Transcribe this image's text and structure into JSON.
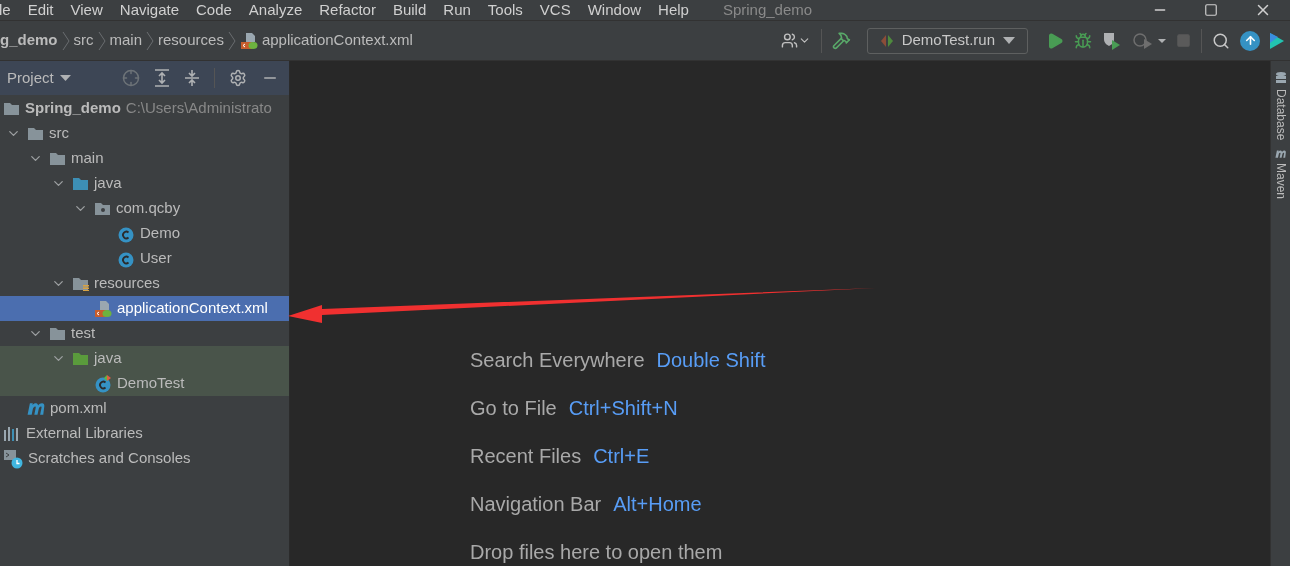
{
  "menu": [
    "le",
    "Edit",
    "View",
    "Navigate",
    "Code",
    "Analyze",
    "Refactor",
    "Build",
    "Run",
    "Tools",
    "VCS",
    "Window",
    "Help"
  ],
  "window": {
    "title": "Spring_demo"
  },
  "breadcrumbs": [
    {
      "label": "g_demo",
      "kind": "project"
    },
    {
      "label": "src",
      "kind": "folder"
    },
    {
      "label": "main",
      "kind": "folder"
    },
    {
      "label": "resources",
      "kind": "folder"
    },
    {
      "label": "applicationContext.xml",
      "kind": "xml"
    }
  ],
  "run_config": {
    "label": "DemoTest.run"
  },
  "project_panel": {
    "title": "Project"
  },
  "tree": [
    {
      "label": "Spring_demo",
      "path": "C:\\Users\\Administrato",
      "kind": "project",
      "selected": false,
      "children": [
        {
          "label": "src",
          "kind": "folder",
          "expanded": true,
          "selected": false,
          "children": [
            {
              "label": "main",
              "kind": "folder",
              "expanded": true,
              "selected": false,
              "children": [
                {
                  "label": "java",
                  "kind": "source-folder",
                  "expanded": true,
                  "selected": false,
                  "children": [
                    {
                      "label": "com.qcby",
                      "kind": "package",
                      "expanded": true,
                      "selected": false,
                      "children": [
                        {
                          "label": "Demo",
                          "kind": "class",
                          "selected": false
                        },
                        {
                          "label": "User",
                          "kind": "class",
                          "selected": false
                        }
                      ]
                    }
                  ]
                },
                {
                  "label": "resources",
                  "kind": "resources-folder",
                  "expanded": true,
                  "selected": false,
                  "children": [
                    {
                      "label": "applicationContext.xml",
                      "kind": "xml",
                      "selected": true
                    }
                  ]
                }
              ]
            },
            {
              "label": "test",
              "kind": "folder",
              "expanded": true,
              "selected": false,
              "children": [
                {
                  "label": "java",
                  "kind": "test-folder",
                  "expanded": true,
                  "selected": false,
                  "children": [
                    {
                      "label": "DemoTest",
                      "kind": "test-class",
                      "selected": false
                    }
                  ]
                }
              ]
            }
          ]
        },
        {
          "label": "pom.xml",
          "kind": "maven",
          "selected": false
        }
      ]
    },
    {
      "label": "External Libraries",
      "kind": "libraries",
      "selected": false
    },
    {
      "label": "Scratches and Consoles",
      "kind": "scratches",
      "selected": false
    }
  ],
  "welcome": [
    {
      "action": "Search Everywhere",
      "shortcut": "Double Shift"
    },
    {
      "action": "Go to File",
      "shortcut": "Ctrl+Shift+N"
    },
    {
      "action": "Recent Files",
      "shortcut": "Ctrl+E"
    },
    {
      "action": "Navigation Bar",
      "shortcut": "Alt+Home"
    },
    {
      "action": "Drop files here to open them"
    }
  ],
  "right_strip": [
    "Database",
    "Maven"
  ]
}
